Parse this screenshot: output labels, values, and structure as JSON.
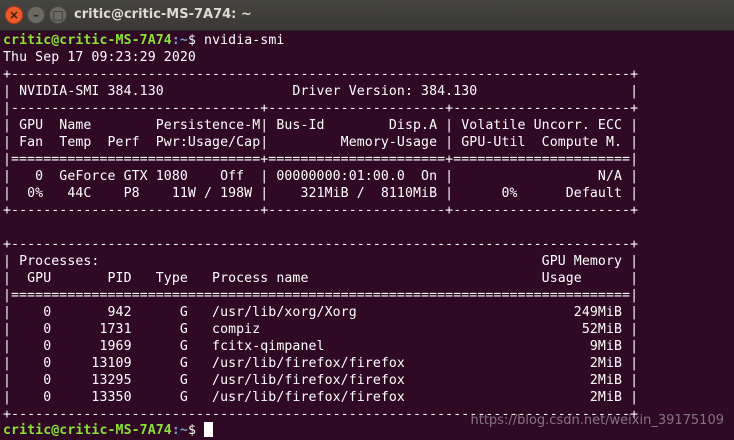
{
  "window": {
    "title": "critic@critic-MS-7A74: ~",
    "close_glyph": "×",
    "minimize_glyph": "–",
    "maximize_glyph": "□"
  },
  "terminal": {
    "prompt_user": "critic@critic-MS-7A74",
    "prompt_path": ":~",
    "prompt_symbol": "$ ",
    "command": "nvidia-smi",
    "date": "Thu Sep 17 09:23:29 2020",
    "lines": [
      "+-----------------------------------------------------------------------------+",
      "| NVIDIA-SMI 384.130                Driver Version: 384.130                   |",
      "|-------------------------------+----------------------+----------------------+",
      "| GPU  Name        Persistence-M| Bus-Id        Disp.A | Volatile Uncorr. ECC |",
      "| Fan  Temp  Perf  Pwr:Usage/Cap|         Memory-Usage | GPU-Util  Compute M. |",
      "|===============================+======================+======================|",
      "|   0  GeForce GTX 1080    Off  | 00000000:01:00.0  On |                  N/A |",
      "|  0%   44C    P8    11W / 198W |    321MiB /  8110MiB |      0%      Default |",
      "+-------------------------------+----------------------+----------------------+",
      "",
      "+-----------------------------------------------------------------------------+",
      "| Processes:                                                       GPU Memory |",
      "|  GPU       PID   Type   Process name                             Usage      |",
      "|=============================================================================|",
      "|    0       942      G   /usr/lib/xorg/Xorg                           249MiB |",
      "|    0      1731      G   compiz                                        52MiB |",
      "|    0      1969      G   fcitx-qimpanel                                 9MiB |",
      "|    0     13109      G   /usr/lib/firefox/firefox                       2MiB |",
      "|    0     13295      G   /usr/lib/firefox/firefox                       2MiB |",
      "|    0     13350      G   /usr/lib/firefox/firefox                       2MiB |",
      "+-----------------------------------------------------------------------------+"
    ]
  },
  "watermark": "https://blog.csdn.net/weixin_39175109"
}
